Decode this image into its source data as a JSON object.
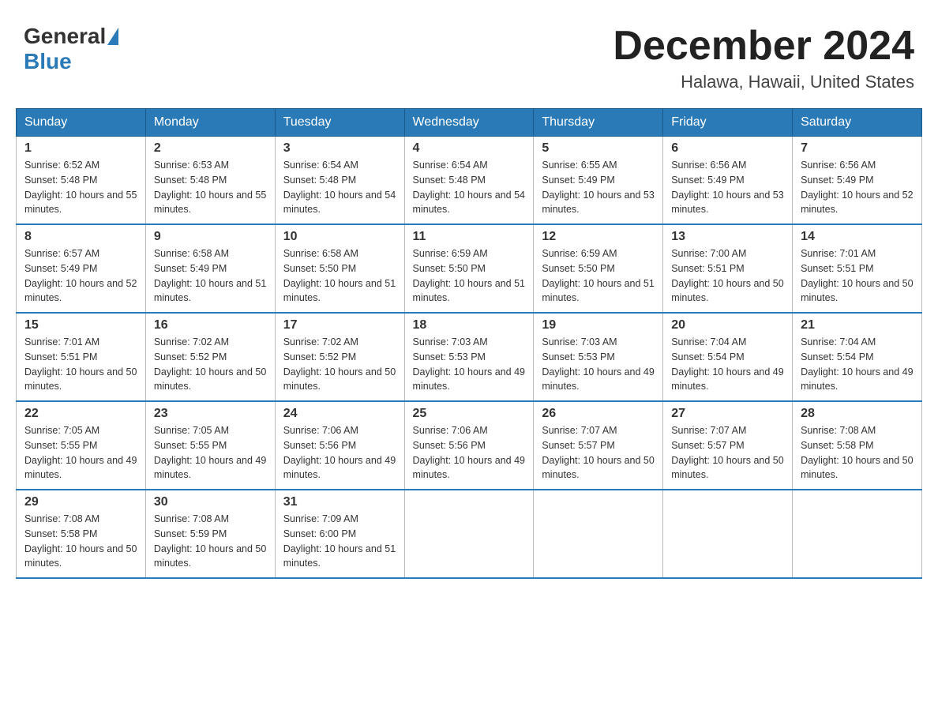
{
  "header": {
    "logo_general": "General",
    "logo_blue": "Blue",
    "month_title": "December 2024",
    "location": "Halawa, Hawaii, United States"
  },
  "days_of_week": [
    "Sunday",
    "Monday",
    "Tuesday",
    "Wednesday",
    "Thursday",
    "Friday",
    "Saturday"
  ],
  "weeks": [
    [
      {
        "day": "1",
        "sunrise": "6:52 AM",
        "sunset": "5:48 PM",
        "daylight": "10 hours and 55 minutes."
      },
      {
        "day": "2",
        "sunrise": "6:53 AM",
        "sunset": "5:48 PM",
        "daylight": "10 hours and 55 minutes."
      },
      {
        "day": "3",
        "sunrise": "6:54 AM",
        "sunset": "5:48 PM",
        "daylight": "10 hours and 54 minutes."
      },
      {
        "day": "4",
        "sunrise": "6:54 AM",
        "sunset": "5:48 PM",
        "daylight": "10 hours and 54 minutes."
      },
      {
        "day": "5",
        "sunrise": "6:55 AM",
        "sunset": "5:49 PM",
        "daylight": "10 hours and 53 minutes."
      },
      {
        "day": "6",
        "sunrise": "6:56 AM",
        "sunset": "5:49 PM",
        "daylight": "10 hours and 53 minutes."
      },
      {
        "day": "7",
        "sunrise": "6:56 AM",
        "sunset": "5:49 PM",
        "daylight": "10 hours and 52 minutes."
      }
    ],
    [
      {
        "day": "8",
        "sunrise": "6:57 AM",
        "sunset": "5:49 PM",
        "daylight": "10 hours and 52 minutes."
      },
      {
        "day": "9",
        "sunrise": "6:58 AM",
        "sunset": "5:49 PM",
        "daylight": "10 hours and 51 minutes."
      },
      {
        "day": "10",
        "sunrise": "6:58 AM",
        "sunset": "5:50 PM",
        "daylight": "10 hours and 51 minutes."
      },
      {
        "day": "11",
        "sunrise": "6:59 AM",
        "sunset": "5:50 PM",
        "daylight": "10 hours and 51 minutes."
      },
      {
        "day": "12",
        "sunrise": "6:59 AM",
        "sunset": "5:50 PM",
        "daylight": "10 hours and 51 minutes."
      },
      {
        "day": "13",
        "sunrise": "7:00 AM",
        "sunset": "5:51 PM",
        "daylight": "10 hours and 50 minutes."
      },
      {
        "day": "14",
        "sunrise": "7:01 AM",
        "sunset": "5:51 PM",
        "daylight": "10 hours and 50 minutes."
      }
    ],
    [
      {
        "day": "15",
        "sunrise": "7:01 AM",
        "sunset": "5:51 PM",
        "daylight": "10 hours and 50 minutes."
      },
      {
        "day": "16",
        "sunrise": "7:02 AM",
        "sunset": "5:52 PM",
        "daylight": "10 hours and 50 minutes."
      },
      {
        "day": "17",
        "sunrise": "7:02 AM",
        "sunset": "5:52 PM",
        "daylight": "10 hours and 50 minutes."
      },
      {
        "day": "18",
        "sunrise": "7:03 AM",
        "sunset": "5:53 PM",
        "daylight": "10 hours and 49 minutes."
      },
      {
        "day": "19",
        "sunrise": "7:03 AM",
        "sunset": "5:53 PM",
        "daylight": "10 hours and 49 minutes."
      },
      {
        "day": "20",
        "sunrise": "7:04 AM",
        "sunset": "5:54 PM",
        "daylight": "10 hours and 49 minutes."
      },
      {
        "day": "21",
        "sunrise": "7:04 AM",
        "sunset": "5:54 PM",
        "daylight": "10 hours and 49 minutes."
      }
    ],
    [
      {
        "day": "22",
        "sunrise": "7:05 AM",
        "sunset": "5:55 PM",
        "daylight": "10 hours and 49 minutes."
      },
      {
        "day": "23",
        "sunrise": "7:05 AM",
        "sunset": "5:55 PM",
        "daylight": "10 hours and 49 minutes."
      },
      {
        "day": "24",
        "sunrise": "7:06 AM",
        "sunset": "5:56 PM",
        "daylight": "10 hours and 49 minutes."
      },
      {
        "day": "25",
        "sunrise": "7:06 AM",
        "sunset": "5:56 PM",
        "daylight": "10 hours and 49 minutes."
      },
      {
        "day": "26",
        "sunrise": "7:07 AM",
        "sunset": "5:57 PM",
        "daylight": "10 hours and 50 minutes."
      },
      {
        "day": "27",
        "sunrise": "7:07 AM",
        "sunset": "5:57 PM",
        "daylight": "10 hours and 50 minutes."
      },
      {
        "day": "28",
        "sunrise": "7:08 AM",
        "sunset": "5:58 PM",
        "daylight": "10 hours and 50 minutes."
      }
    ],
    [
      {
        "day": "29",
        "sunrise": "7:08 AM",
        "sunset": "5:58 PM",
        "daylight": "10 hours and 50 minutes."
      },
      {
        "day": "30",
        "sunrise": "7:08 AM",
        "sunset": "5:59 PM",
        "daylight": "10 hours and 50 minutes."
      },
      {
        "day": "31",
        "sunrise": "7:09 AM",
        "sunset": "6:00 PM",
        "daylight": "10 hours and 51 minutes."
      },
      null,
      null,
      null,
      null
    ]
  ]
}
